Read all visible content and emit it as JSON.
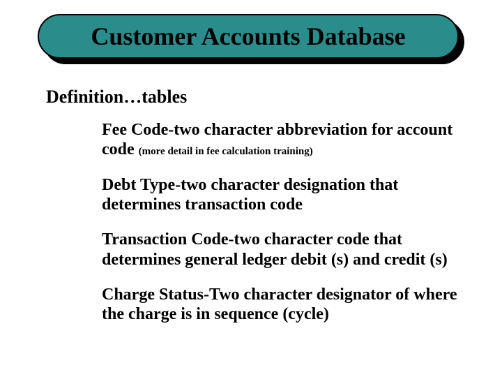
{
  "title": "Customer Accounts Database",
  "subheading": "Definition…tables",
  "items": {
    "fee_code_main": "Fee Code-two character abbreviation for account code ",
    "fee_code_note": "(more detail in fee calculation training)",
    "debt_type": "Debt Type-two character designation that determines transaction code",
    "transaction_code": "Transaction Code-two character code that determines general ledger debit (s) and credit (s)",
    "charge_status": "Charge Status-Two character designator of where the charge is in sequence (cycle)"
  }
}
